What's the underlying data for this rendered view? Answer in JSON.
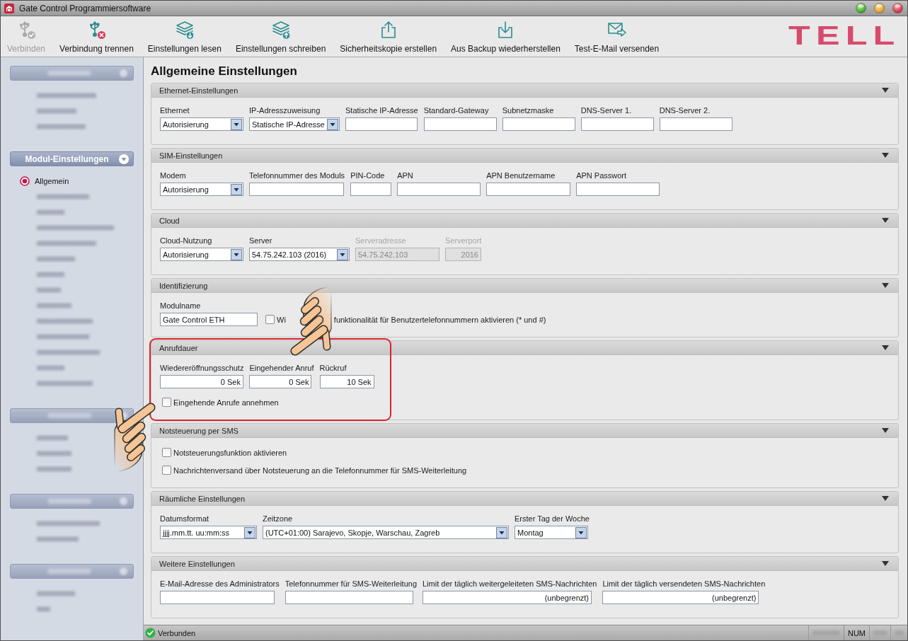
{
  "window": {
    "title": "Gate Control Programmiersoftware"
  },
  "toolbar": {
    "buttons": [
      {
        "label": "Verbinden",
        "disabled": true
      },
      {
        "label": "Verbindung trennen",
        "disabled": false
      },
      {
        "label": "Einstellungen lesen",
        "disabled": false
      },
      {
        "label": "Einstellungen schreiben",
        "disabled": false
      },
      {
        "label": "Sicherheitskopie erstellen",
        "disabled": false
      },
      {
        "label": "Aus Backup wiederherstellen",
        "disabled": false
      },
      {
        "label": "Test-E-Mail versenden",
        "disabled": false
      }
    ],
    "logo": "TELL"
  },
  "sidebar": {
    "groups": [
      {
        "kind": "blurred",
        "items": [
          {
            "kind": "blurred"
          },
          {
            "kind": "blurred"
          },
          {
            "kind": "blurred"
          }
        ]
      },
      {
        "kind": "group",
        "title": "Modul-Einstellungen",
        "items": [
          {
            "kind": "item",
            "label": "Allgemein",
            "selected": true
          },
          {
            "kind": "blurred"
          },
          {
            "kind": "blurred"
          },
          {
            "kind": "blurred"
          },
          {
            "kind": "blurred"
          },
          {
            "kind": "blurred"
          },
          {
            "kind": "blurred"
          },
          {
            "kind": "blurred"
          },
          {
            "kind": "blurred"
          },
          {
            "kind": "blurred"
          },
          {
            "kind": "blurred"
          },
          {
            "kind": "blurred"
          },
          {
            "kind": "blurred"
          },
          {
            "kind": "blurred"
          }
        ]
      },
      {
        "kind": "blurred",
        "items": [
          {
            "kind": "blurred"
          },
          {
            "kind": "blurred"
          },
          {
            "kind": "blurred"
          }
        ]
      },
      {
        "kind": "blurred",
        "items": [
          {
            "kind": "blurred"
          },
          {
            "kind": "blurred"
          }
        ]
      },
      {
        "kind": "blurred",
        "items": [
          {
            "kind": "blurred"
          },
          {
            "kind": "blurred"
          }
        ]
      }
    ]
  },
  "page_title": "Allgemeine Einstellungen",
  "sections": [
    {
      "title": "Ethernet-Einstellungen",
      "highlighted": false,
      "rows": [
        {
          "fields": [
            {
              "kind": "select",
              "label": "Ethernet",
              "value": "Autorisierung",
              "disabled": false
            },
            {
              "kind": "select",
              "label": "IP-Adresszuweisung",
              "value": "Statische IP-Adresse",
              "disabled": false
            },
            {
              "kind": "text",
              "label": "Statische IP-Adresse",
              "disabled": false
            },
            {
              "kind": "text",
              "label": "Standard-Gateway",
              "disabled": false
            },
            {
              "kind": "text",
              "label": "Subnetzmaske",
              "disabled": false
            },
            {
              "kind": "text",
              "label": "DNS-Server 1.",
              "disabled": false
            },
            {
              "kind": "text",
              "label": "DNS-Server 2.",
              "disabled": false
            }
          ]
        }
      ]
    },
    {
      "title": "SIM-Einstellungen",
      "highlighted": false,
      "rows": [
        {
          "fields": [
            {
              "kind": "select",
              "label": "Modem",
              "value": "Autorisierung",
              "disabled": false
            },
            {
              "kind": "text",
              "label": "Telefonnummer des Moduls",
              "disabled": false
            },
            {
              "kind": "text",
              "label": "PIN-Code",
              "disabled": false
            },
            {
              "kind": "text",
              "label": "APN",
              "disabled": false
            },
            {
              "kind": "text",
              "label": "APN Benutzername",
              "disabled": false
            },
            {
              "kind": "text",
              "label": "APN Passwort",
              "disabled": false
            }
          ]
        }
      ]
    },
    {
      "title": "Cloud",
      "highlighted": false,
      "rows": [
        {
          "fields": [
            {
              "kind": "select",
              "label": "Cloud-Nutzung",
              "value": "Autorisierung",
              "disabled": false
            },
            {
              "kind": "select",
              "label": "Server",
              "value": "54.75.242.103 (2016)",
              "disabled": false
            },
            {
              "kind": "text",
              "label": "Serveradresse",
              "value": "54.75.242.103",
              "disabled": true
            },
            {
              "kind": "number",
              "label": "Serverport",
              "value": "2016",
              "disabled": true
            }
          ]
        }
      ]
    },
    {
      "title": "Identifizierung",
      "highlighted": false,
      "rows": [
        {
          "fields": [
            {
              "kind": "text",
              "label": "Modulname",
              "value": "Gate Control ETH",
              "disabled": false
            },
            {
              "kind": "checkbox",
              "checked": false,
              "label_parts": [
                "Wi",
                "funktionalität für Benutzertelefonnummern aktivieren (* und #)"
              ]
            }
          ]
        }
      ]
    },
    {
      "title": "Anrufdauer",
      "highlighted": true,
      "rows": [
        {
          "fields": [
            {
              "kind": "number",
              "label": "Wiedereröffnungsschutz",
              "value": "0 Sek",
              "disabled": false
            },
            {
              "kind": "number",
              "label": "Eingehender Anruf",
              "value": "0 Sek",
              "disabled": false
            },
            {
              "kind": "number",
              "label": "Rückruf",
              "value": "10 Sek",
              "disabled": false
            }
          ]
        },
        {
          "fields": [
            {
              "kind": "checkbox",
              "checked": false,
              "label_parts": [
                "Eingehende Anrufe annehmen"
              ]
            }
          ]
        }
      ]
    },
    {
      "title": "Notsteuerung per SMS",
      "highlighted": false,
      "rows": [
        {
          "fields": [
            {
              "kind": "checkbox",
              "checked": false,
              "label_parts": [
                "Notsteuerungsfunktion aktivieren"
              ]
            }
          ]
        },
        {
          "fields": [
            {
              "kind": "checkbox",
              "checked": false,
              "label_parts": [
                "Nachrichtenversand über Notsteuerung an die Telefonnummer für SMS-Weiterleitung"
              ]
            }
          ]
        }
      ]
    },
    {
      "title": "Räumliche Einstellungen",
      "highlighted": false,
      "rows": [
        {
          "fields": [
            {
              "kind": "select",
              "label": "Datumsformat",
              "value": "jjjj.mm.tt. uu:mm:ss",
              "disabled": false
            },
            {
              "kind": "select",
              "label": "Zeitzone",
              "value": "(UTC+01:00) Sarajevo, Skopje, Warschau, Zagreb",
              "disabled": false
            },
            {
              "kind": "select",
              "label": "Erster Tag der Woche",
              "value": "Montag",
              "disabled": false
            }
          ]
        }
      ]
    },
    {
      "title": "Weitere Einstellungen",
      "highlighted": false,
      "rows": [
        {
          "fields": [
            {
              "kind": "text",
              "label": "E-Mail-Adresse des Administrators",
              "disabled": false
            },
            {
              "kind": "text",
              "label": "Telefonnummer für SMS-Weiterleitung",
              "disabled": false
            },
            {
              "kind": "number",
              "label": "Limit der täglich weitergeleiteten SMS-Nachrichten",
              "value": "(unbegrenzt)",
              "disabled": false
            },
            {
              "kind": "number",
              "label": "Limit der täglich versendeten SMS-Nachrichten",
              "value": "(unbegrenzt)",
              "disabled": false
            }
          ]
        }
      ]
    }
  ],
  "status_bar": {
    "status": "Verbunden",
    "indicators": [
      {
        "kind": "blurred"
      },
      {
        "kind": "text",
        "label": "NUM"
      },
      {
        "kind": "blurred"
      },
      {
        "kind": "blurred"
      }
    ]
  }
}
